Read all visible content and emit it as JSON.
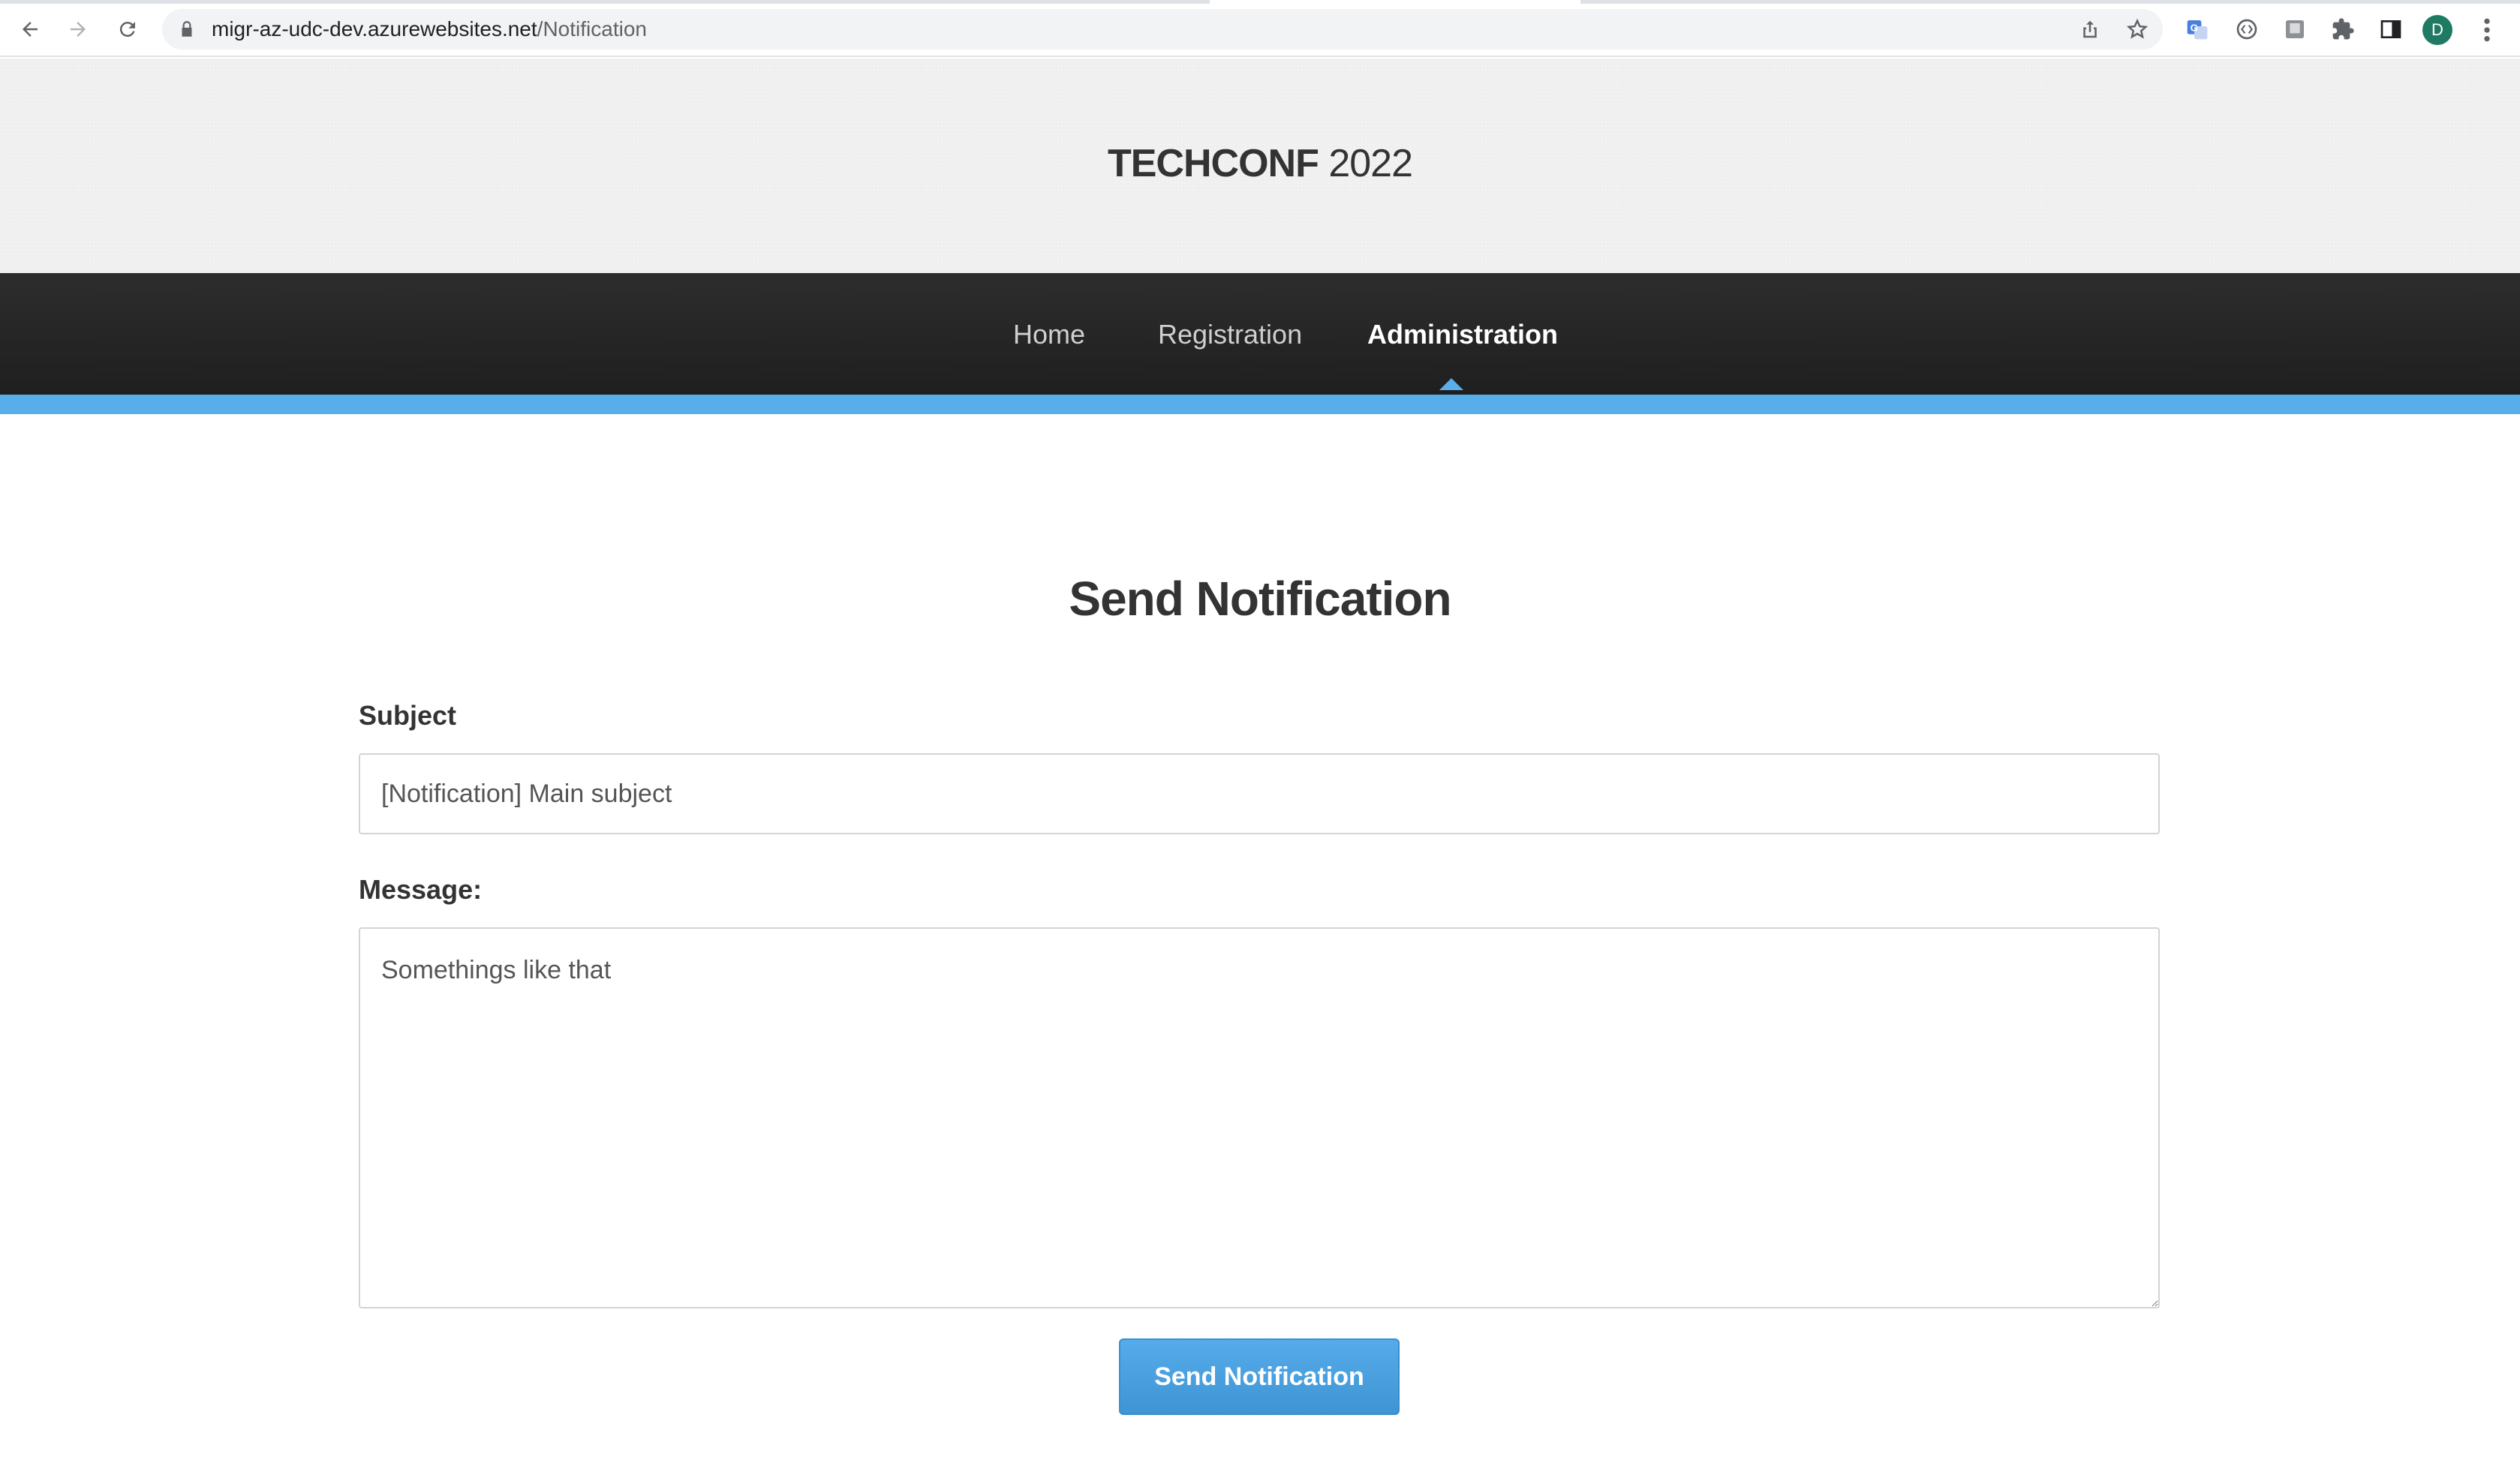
{
  "browser": {
    "url_host": "migr-az-udc-dev.azurewebsites.net",
    "url_path": "/Notification",
    "profile_initial": "D"
  },
  "site": {
    "brand": "TECHCONF",
    "year": "2022"
  },
  "nav": {
    "items": [
      {
        "label": "Home",
        "active": false
      },
      {
        "label": "Registration",
        "active": false
      },
      {
        "label": "Administration",
        "active": true
      }
    ]
  },
  "form": {
    "title": "Send Notification",
    "subject_label": "Subject",
    "subject_value": "[Notification] Main subject",
    "message_label": "Message:",
    "message_value": "Somethings like that",
    "submit_label": "Send Notification"
  },
  "colors": {
    "accent": "#58aeea",
    "nav_background": "#262626",
    "button": "#4ca2df"
  }
}
